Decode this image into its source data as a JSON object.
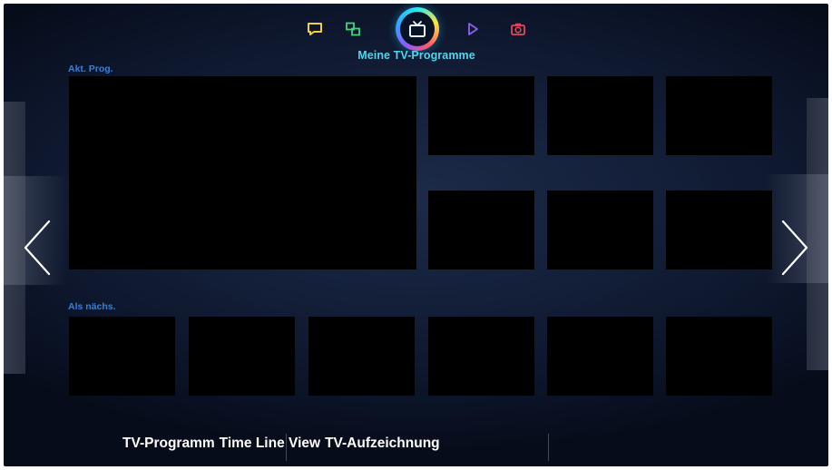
{
  "top_bar": {
    "icons": [
      "social-icon",
      "multiscreen-icon",
      "tv-icon",
      "play-icon",
      "camera-icon"
    ],
    "active": "tv-icon",
    "title": "Meine TV-Programme"
  },
  "sections": {
    "now_label": "Akt. Prog.",
    "next_label": "Als nächs."
  },
  "navigation": {
    "left": "chevron-left-icon",
    "right": "chevron-right-icon"
  },
  "bottom_menu": {
    "items": [
      "TV-Programm",
      "Time Line View",
      "TV-Aufzeichnung"
    ]
  },
  "colors": {
    "accent": "#4fd6ee",
    "section_label": "#3d7fd0",
    "background": "#14203a",
    "tile": "#000000"
  }
}
